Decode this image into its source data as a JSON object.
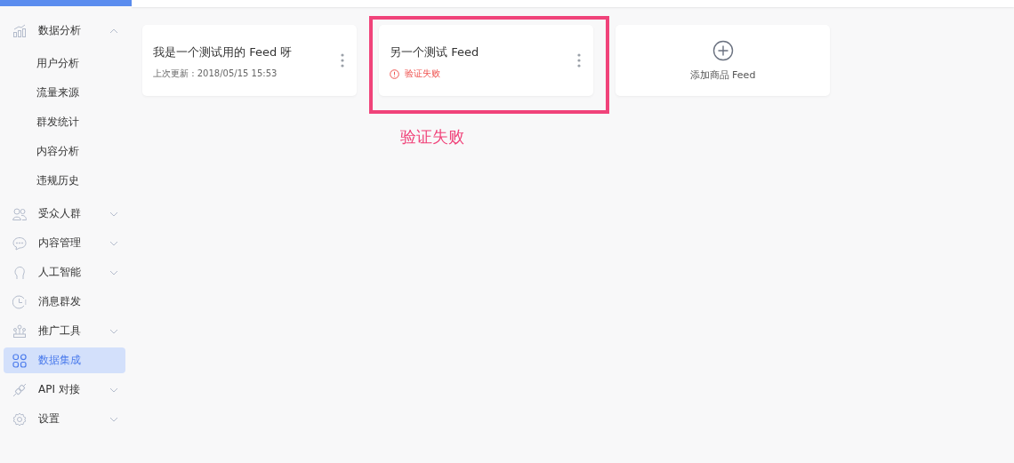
{
  "sidebar": {
    "items": [
      {
        "label": "数据分析",
        "kind": "group",
        "expanded": true,
        "selected": false,
        "children": [
          {
            "label": "用户分析",
            "selected": false
          },
          {
            "label": "流量来源",
            "selected": false
          },
          {
            "label": "群发统计",
            "selected": false
          },
          {
            "label": "内容分析",
            "selected": false
          },
          {
            "label": "违规历史",
            "selected": false
          }
        ]
      },
      {
        "label": "受众人群",
        "kind": "group",
        "expanded": false,
        "selected": false
      },
      {
        "label": "内容管理",
        "kind": "group",
        "expanded": false,
        "selected": false
      },
      {
        "label": "人工智能",
        "kind": "group",
        "expanded": false,
        "selected": false
      },
      {
        "label": "消息群发",
        "kind": "link",
        "selected": false
      },
      {
        "label": "推广工具",
        "kind": "group",
        "expanded": false,
        "selected": false
      },
      {
        "label": "数据集成",
        "kind": "link",
        "selected": true
      },
      {
        "label": "API 对接",
        "kind": "group",
        "expanded": false,
        "selected": false
      },
      {
        "label": "设置",
        "kind": "group",
        "expanded": false,
        "selected": false
      }
    ]
  },
  "feeds": [
    {
      "title": "我是一个测试用的 Feed 呀",
      "kind": "updated",
      "highlighted": false,
      "detail": "上次更新 : 2018/05/15 15:53"
    },
    {
      "title": "另一个测试 Feed",
      "kind": "error",
      "highlighted": true,
      "detail": "验证失败"
    }
  ],
  "add_card": {
    "label": "添加商品 Feed"
  },
  "annotation": {
    "label": "验证失败"
  }
}
